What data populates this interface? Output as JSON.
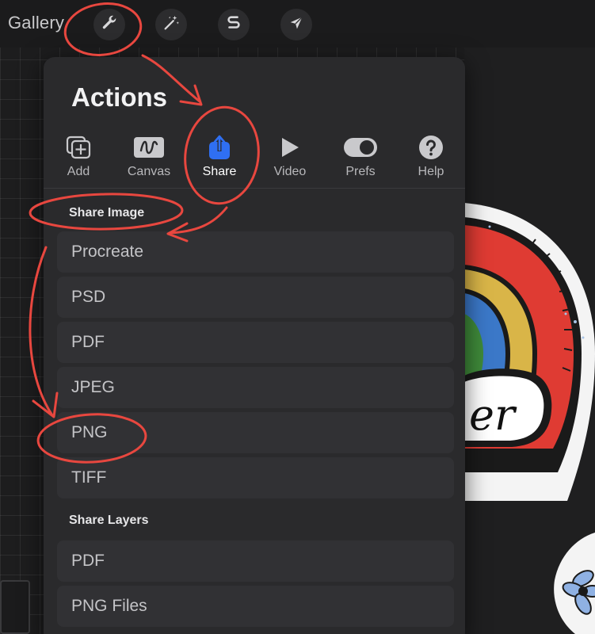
{
  "topbar": {
    "gallery_label": "Gallery",
    "tools": [
      {
        "name": "actions-wrench",
        "icon": "wrench-icon"
      },
      {
        "name": "adjustments",
        "icon": "magic-wand-icon"
      },
      {
        "name": "selection",
        "icon": "selection-s-icon"
      },
      {
        "name": "transform",
        "icon": "arrow-cursor-icon"
      }
    ]
  },
  "panel": {
    "title": "Actions",
    "tabs": [
      {
        "label": "Add",
        "icon": "add-icon"
      },
      {
        "label": "Canvas",
        "icon": "canvas-icon"
      },
      {
        "label": "Share",
        "icon": "share-icon",
        "active": true
      },
      {
        "label": "Video",
        "icon": "play-icon"
      },
      {
        "label": "Prefs",
        "icon": "toggle-icon"
      },
      {
        "label": "Help",
        "icon": "help-icon"
      }
    ],
    "share_image_header": "Share Image",
    "share_image_items": [
      "Procreate",
      "PSD",
      "PDF",
      "JPEG",
      "PNG",
      "TIFF"
    ],
    "share_layers_header": "Share Layers",
    "share_layers_items": [
      "PDF",
      "PNG Files"
    ]
  },
  "colors": {
    "accent_blue": "#2f6ff2",
    "annotation_red": "#e8473f",
    "panel_bg": "#2a2a2c",
    "row_bg": "#313134"
  }
}
